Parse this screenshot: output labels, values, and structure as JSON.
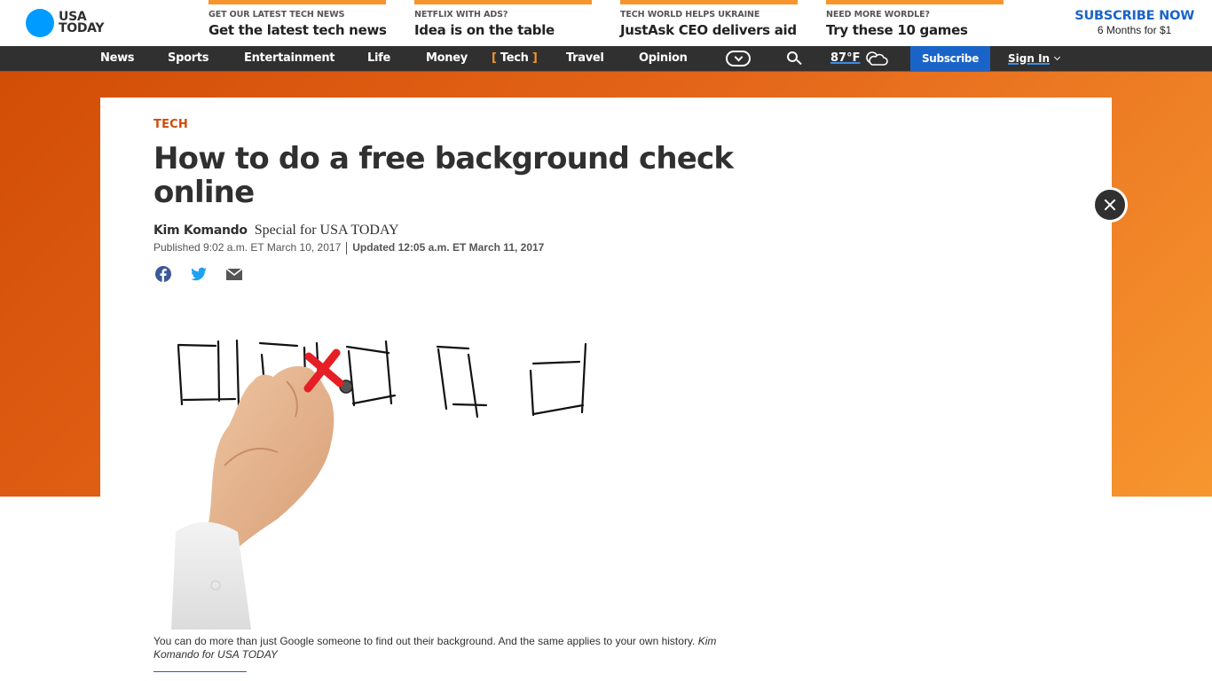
{
  "header": {
    "logo": {
      "line1": "USA",
      "line2": "TODAY",
      "color": "#009bff"
    },
    "promos": [
      {
        "kicker": "GET OUR LATEST TECH NEWS",
        "title": "Get the latest tech news"
      },
      {
        "kicker": "NETFLIX WITH ADS?",
        "title": "Idea is on the table"
      },
      {
        "kicker": "TECH WORLD HELPS UKRAINE",
        "title": "JustAsk CEO delivers aid"
      },
      {
        "kicker": "NEED MORE WORDLE?",
        "title": "Try these 10 games"
      }
    ],
    "subscribe_cta": {
      "title": "SUBSCRIBE NOW",
      "subtitle": "6 Months for $1"
    }
  },
  "nav": {
    "items": [
      {
        "label": "News"
      },
      {
        "label": "Sports"
      },
      {
        "label": "Entertainment"
      },
      {
        "label": "Life"
      },
      {
        "label": "Money"
      },
      {
        "label": "Tech",
        "active": true
      },
      {
        "label": "Travel"
      },
      {
        "label": "Opinion"
      }
    ],
    "more_icon": "chevron-circle-icon",
    "search_icon": "search-icon",
    "temperature": "87°F",
    "weather_icon": "partly-cloudy-icon",
    "subscribe_label": "Subscribe",
    "signin_label": "Sign In",
    "accent": "#1a64c9"
  },
  "article": {
    "section": "TECH",
    "headline": "How to do a free background check online",
    "author": "Kim Komando",
    "affiliation": "Special for USA TODAY",
    "published": "Published 9:02 a.m. ET March 10, 2017",
    "updated": "Updated 12:05 a.m. ET March 11, 2017",
    "share": [
      "facebook-icon",
      "twitter-icon",
      "email-icon"
    ],
    "image_alt": "Hand drawing checkboxes with a red X in one",
    "caption": "You can do more than just Google someone to find out their background. And the same applies to your own history.",
    "caption_credit": "Kim Komando for USA TODAY"
  },
  "overlay": {
    "close_icon": "close-icon"
  }
}
